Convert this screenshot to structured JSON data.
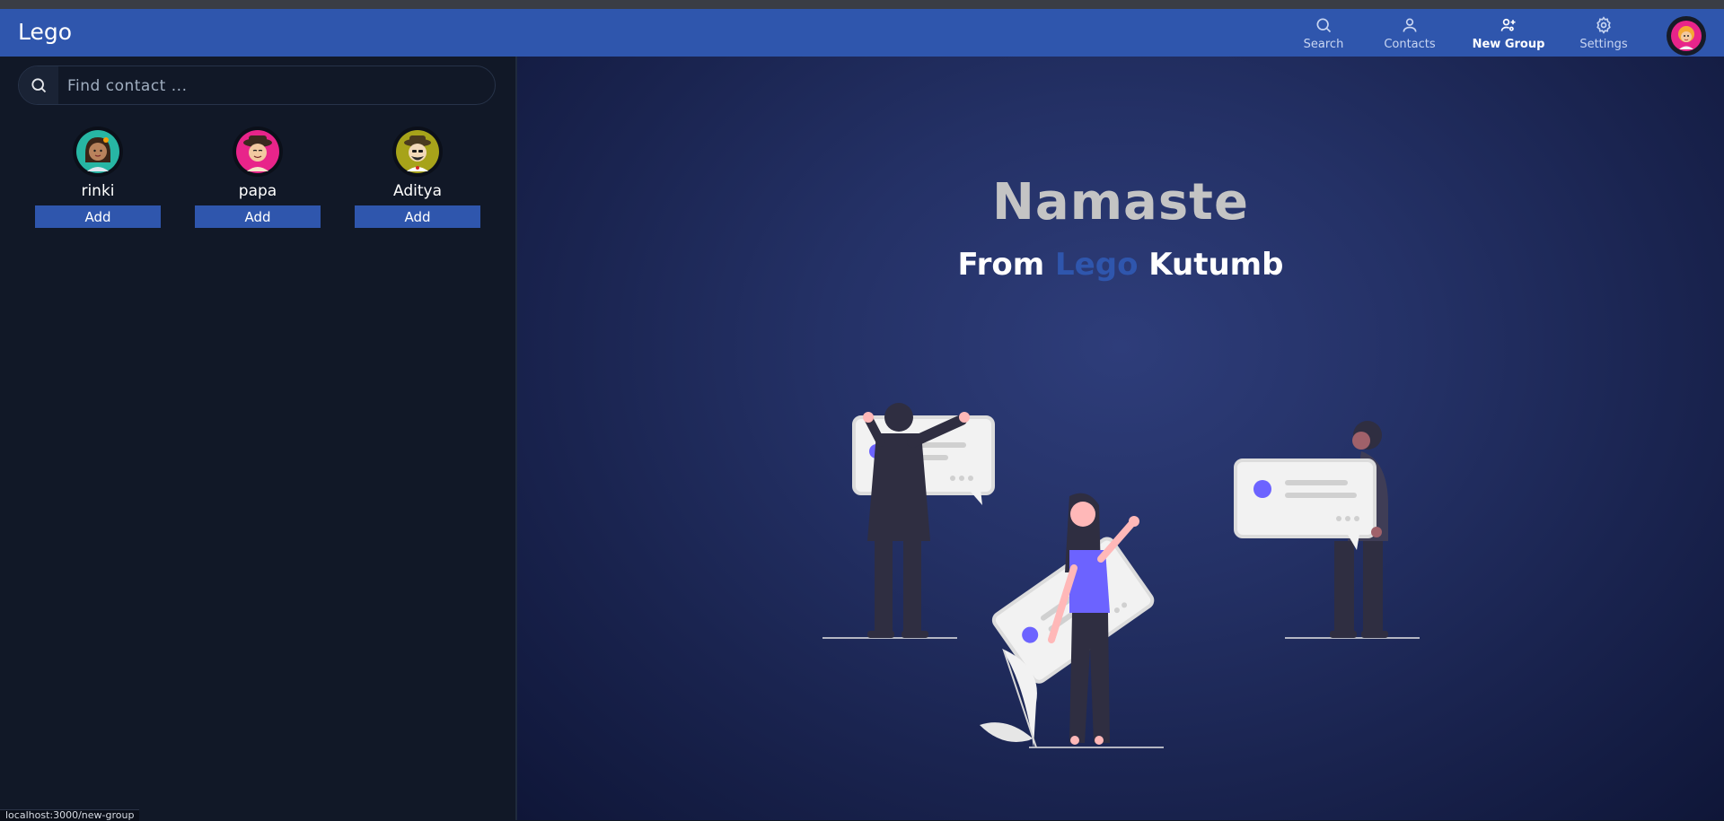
{
  "app": {
    "brand": "Lego"
  },
  "nav": {
    "items": [
      {
        "label": "Search",
        "icon": "search-icon",
        "active": false
      },
      {
        "label": "Contacts",
        "icon": "user-icon",
        "active": false
      },
      {
        "label": "New Group",
        "icon": "users-add-icon",
        "active": true
      },
      {
        "label": "Settings",
        "icon": "gear-icon",
        "active": false
      }
    ],
    "avatar_icon": "profile-avatar-icon"
  },
  "sidebar": {
    "search": {
      "placeholder": "Find contact ...",
      "value": ""
    },
    "contacts": [
      {
        "name": "rinki",
        "button": "Add",
        "avatar_color": "#27b6a4"
      },
      {
        "name": "papa",
        "button": "Add",
        "avatar_color": "#e8248a"
      },
      {
        "name": "Aditya",
        "button": "Add",
        "avatar_color": "#a7a31a"
      }
    ]
  },
  "main": {
    "greeting": "Namaste",
    "tagline": {
      "from": "From",
      "brand": "Lego",
      "rest": "Kutumb"
    }
  },
  "status": {
    "url": "localhost:3000/new-group"
  },
  "colors": {
    "accent": "#2f56ad",
    "sidebar_bg": "#111827",
    "figure_purple": "#6c63ff"
  }
}
